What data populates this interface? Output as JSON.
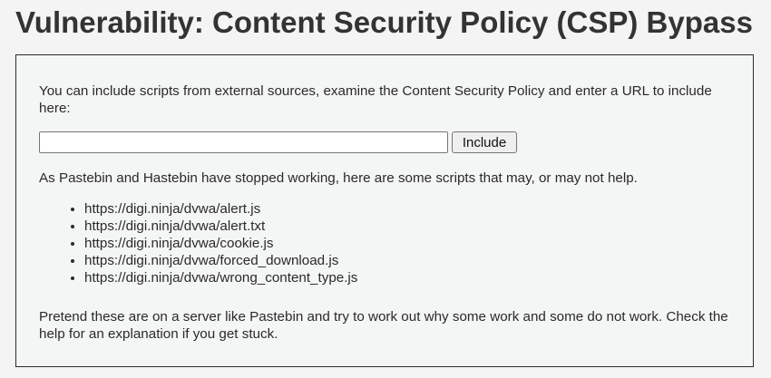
{
  "page": {
    "title": "Vulnerability: Content Security Policy (CSP) Bypass"
  },
  "form": {
    "intro": "You can include scripts from external sources, examine the Content Security Policy and enter a URL to include here:",
    "url_value": "",
    "include_label": "Include"
  },
  "notice": "As Pastebin and Hastebin have stopped working, here are some scripts that may, or may not help.",
  "scripts": [
    "https://digi.ninja/dvwa/alert.js",
    "https://digi.ninja/dvwa/alert.txt",
    "https://digi.ninja/dvwa/cookie.js",
    "https://digi.ninja/dvwa/forced_download.js",
    "https://digi.ninja/dvwa/wrong_content_type.js"
  ],
  "footer": "Pretend these are on a server like Pastebin and try to work out why some work and some do not work. Check the help for an explanation if you get stuck."
}
